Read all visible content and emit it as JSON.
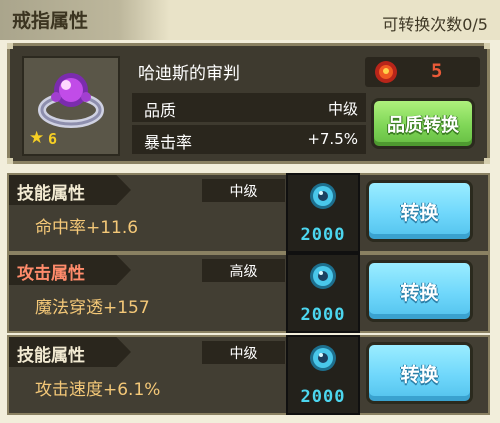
{
  "header": {
    "title": "戒指属性",
    "reroll_count": "可转换次数0/5"
  },
  "item": {
    "name": "哈迪斯的审判",
    "icon": "ring-icon",
    "star_level": "6",
    "badge_value": "5",
    "badge_icon": "fire-orb-icon",
    "stats": [
      {
        "label": "品质",
        "value": "中级"
      },
      {
        "label": "暴击率",
        "value": "+7.5%"
      }
    ],
    "convert_quality_button": "品质转换"
  },
  "attributes": [
    {
      "type": "技能属性",
      "type_color": "#f2ead2",
      "grade": "中级",
      "value": "命中率+11.6",
      "cost": "2000",
      "button": "转换"
    },
    {
      "type": "攻击属性",
      "type_color": "#ff8b6b",
      "grade": "高级",
      "value": "魔法穿透+157",
      "cost": "2000",
      "button": "转换"
    },
    {
      "type": "技能属性",
      "type_color": "#f2ead2",
      "grade": "中级",
      "value": "攻击速度+6.1%",
      "cost": "2000",
      "button": "转换"
    }
  ],
  "colors": {
    "accent_green": "#7fd657",
    "accent_blue": "#6fd7fb",
    "cost_cyan": "#4cd6ef",
    "value_gold": "#f4c878"
  }
}
